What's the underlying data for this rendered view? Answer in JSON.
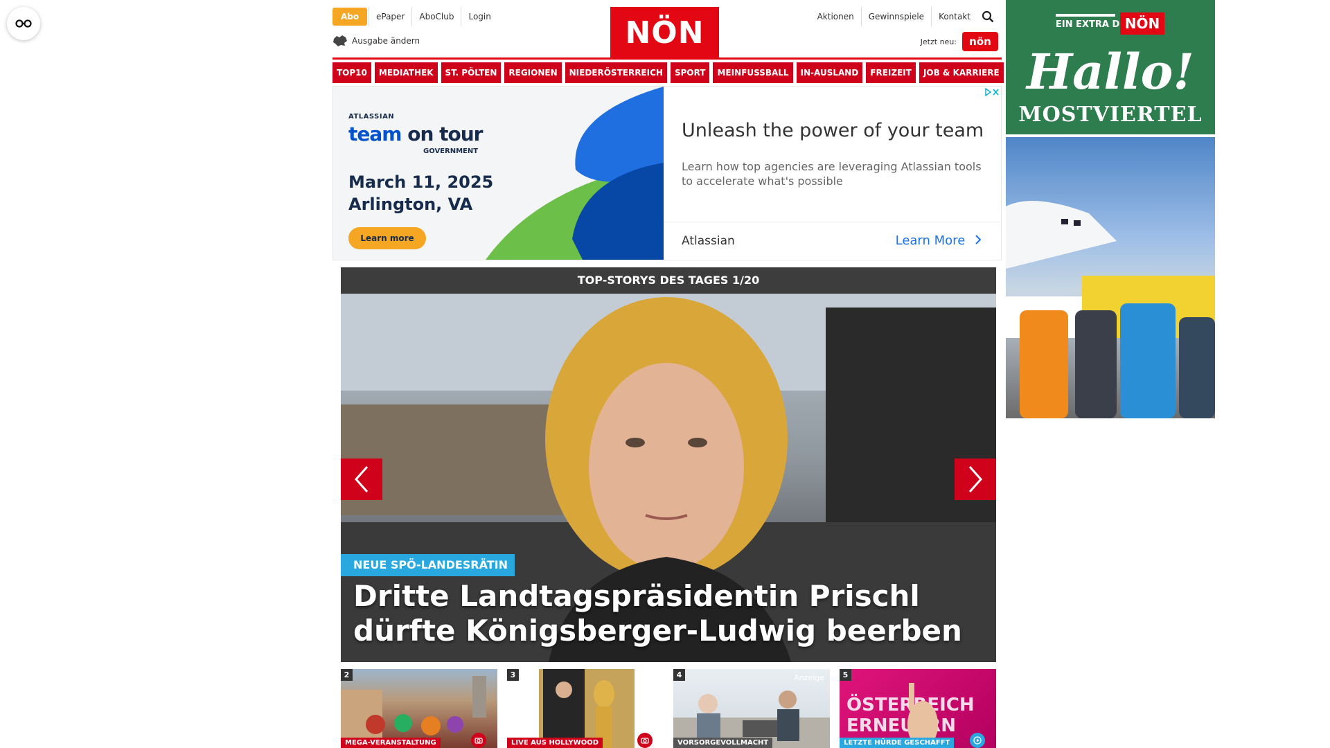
{
  "header": {
    "abo_label": "Abo",
    "top_links": [
      "ePaper",
      "AboClub",
      "Login"
    ],
    "ausgabe_label": "Ausgabe ändern",
    "logo_text": "NÖN",
    "right_links": [
      "Aktionen",
      "Gewinnspiele",
      "Kontakt"
    ],
    "jetzt_label": "Jetzt neu:",
    "jetzt_logo_text": "nön"
  },
  "nav": {
    "items": [
      "TOP10",
      "MEDIATHEK",
      "ST. PÖLTEN",
      "REGIONEN",
      "NIEDERÖSTERREICH",
      "SPORT",
      "MEINFUSSBALL",
      "IN-AUSLAND",
      "FREIZEIT",
      "JOB & KARRIERE"
    ]
  },
  "ad": {
    "brand": "ATLASSIAN",
    "team_blue": "team",
    "team_dark": "on tour",
    "government": "GOVERNMENT",
    "date_line1": "March 11, 2025",
    "date_line2": "Arlington, VA",
    "learn_more_small": "Learn more",
    "headline": "Unleash the power of your team",
    "subtext": "Learn how top agencies are leveraging Atlassian tools to accelerate what's possible",
    "advertiser": "Atlassian",
    "cta": "Learn More",
    "colors": {
      "blue": "#0052cc",
      "green": "#6cc04a",
      "dark_blue": "#0747a6",
      "orange": "#f5a623"
    }
  },
  "top_stories": {
    "title": "TOP-STORYS DES TAGES 1/20",
    "kicker": "NEUE SPÖ-LANDESRÄTIN",
    "headline": "Dritte Landtagspräsidentin Prischl dürfte Königsberger-Ludwig beerben"
  },
  "teasers": [
    {
      "num": "2",
      "tag": "MEGA-VERANSTALTUNG",
      "badge": "camera-icon"
    },
    {
      "num": "3",
      "tag": "LIVE AUS HOLLYWOOD",
      "badge": "camera-icon"
    },
    {
      "num": "4",
      "tag": "VORSORGEVOLLMACHT",
      "anzeige": "Anzeige"
    },
    {
      "num": "5",
      "tag": "LETZTE HÜRDE GESCHAFFT",
      "badge": "play-icon"
    }
  ],
  "sky": {
    "extra_label": "EIN EXTRA DER",
    "logo_text": "NÖN",
    "hallo": "Hallo!",
    "region": "MOSTVIERTEL"
  },
  "colors": {
    "brand_red": "#e30613",
    "nav_red": "#d0021b",
    "kicker_blue": "#29a8e0",
    "abo_orange": "#f5a623",
    "sky_green": "#2e7d4f"
  }
}
